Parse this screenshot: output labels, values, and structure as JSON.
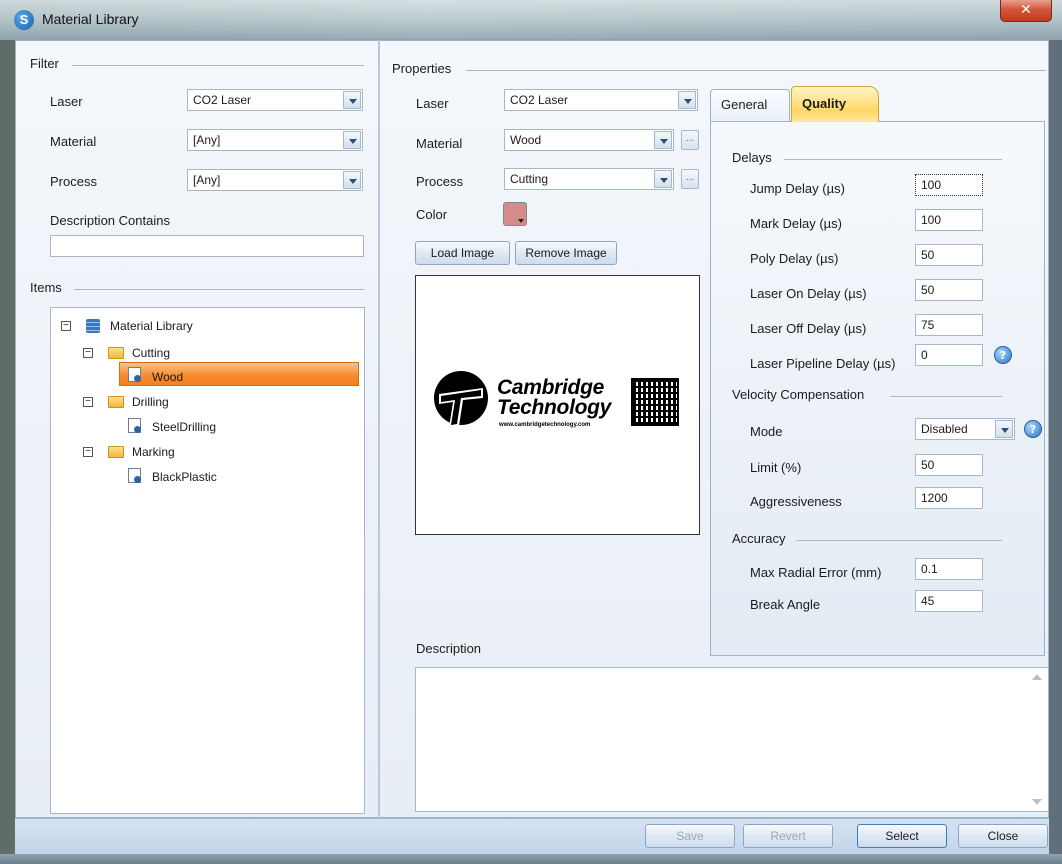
{
  "window": {
    "title": "Material Library",
    "app_icon": "S"
  },
  "filter": {
    "group_label": "Filter",
    "laser_label": "Laser",
    "laser_value": "CO2 Laser",
    "material_label": "Material",
    "material_value": "[Any]",
    "process_label": "Process",
    "process_value": "[Any]",
    "description_label": "Description Contains",
    "description_value": ""
  },
  "items": {
    "group_label": "Items",
    "tree": {
      "root": "Material Library",
      "folders": [
        {
          "label": "Cutting",
          "children": [
            "Wood"
          ]
        },
        {
          "label": "Drilling",
          "children": [
            "SteelDrilling"
          ]
        },
        {
          "label": "Marking",
          "children": [
            "BlackPlastic"
          ]
        }
      ],
      "selected": "Wood"
    }
  },
  "properties": {
    "group_label": "Properties",
    "laser_label": "Laser",
    "laser_value": "CO2 Laser",
    "material_label": "Material",
    "material_value": "Wood",
    "process_label": "Process",
    "process_value": "Cutting",
    "color_label": "Color",
    "color_value": "#d68a8a",
    "load_image": "Load Image",
    "remove_image": "Remove Image",
    "logo_line1": "Cambridge",
    "logo_line2": "Technology",
    "logo_url": "www.cambridgetechnology.com",
    "description_label": "Description",
    "description_value": ""
  },
  "tabs": {
    "general": "General",
    "quality": "Quality",
    "active": "Quality"
  },
  "quality": {
    "delays_label": "Delays",
    "jump_delay_label": "Jump Delay (µs)",
    "jump_delay": "100",
    "mark_delay_label": "Mark Delay (µs)",
    "mark_delay": "100",
    "poly_delay_label": "Poly Delay (µs)",
    "poly_delay": "50",
    "laser_on_label": "Laser On Delay (µs)",
    "laser_on": "50",
    "laser_off_label": "Laser Off Delay (µs)",
    "laser_off": "75",
    "pipeline_label": "Laser Pipeline Delay (µs)",
    "pipeline": "0",
    "velocity_label": "Velocity Compensation",
    "mode_label": "Mode",
    "mode_value": "Disabled",
    "limit_label": "Limit (%)",
    "limit": "50",
    "aggr_label": "Aggressiveness",
    "aggr": "1200",
    "accuracy_label": "Accuracy",
    "radial_label": "Max Radial Error (mm)",
    "radial": "0.1",
    "break_label": "Break Angle",
    "break_angle": "45"
  },
  "footer": {
    "save": "Save",
    "revert": "Revert",
    "select": "Select",
    "close": "Close"
  },
  "icons": {
    "app": "app-logo-icon",
    "close": "close-icon",
    "dropdown": "chevron-down-icon",
    "folder": "folder-icon",
    "library": "database-icon",
    "item": "material-item-icon",
    "help": "help-icon"
  },
  "colors": {
    "selection": "#f48022",
    "quality_tab": "#ffd763",
    "frame": "#9fb1c1"
  }
}
